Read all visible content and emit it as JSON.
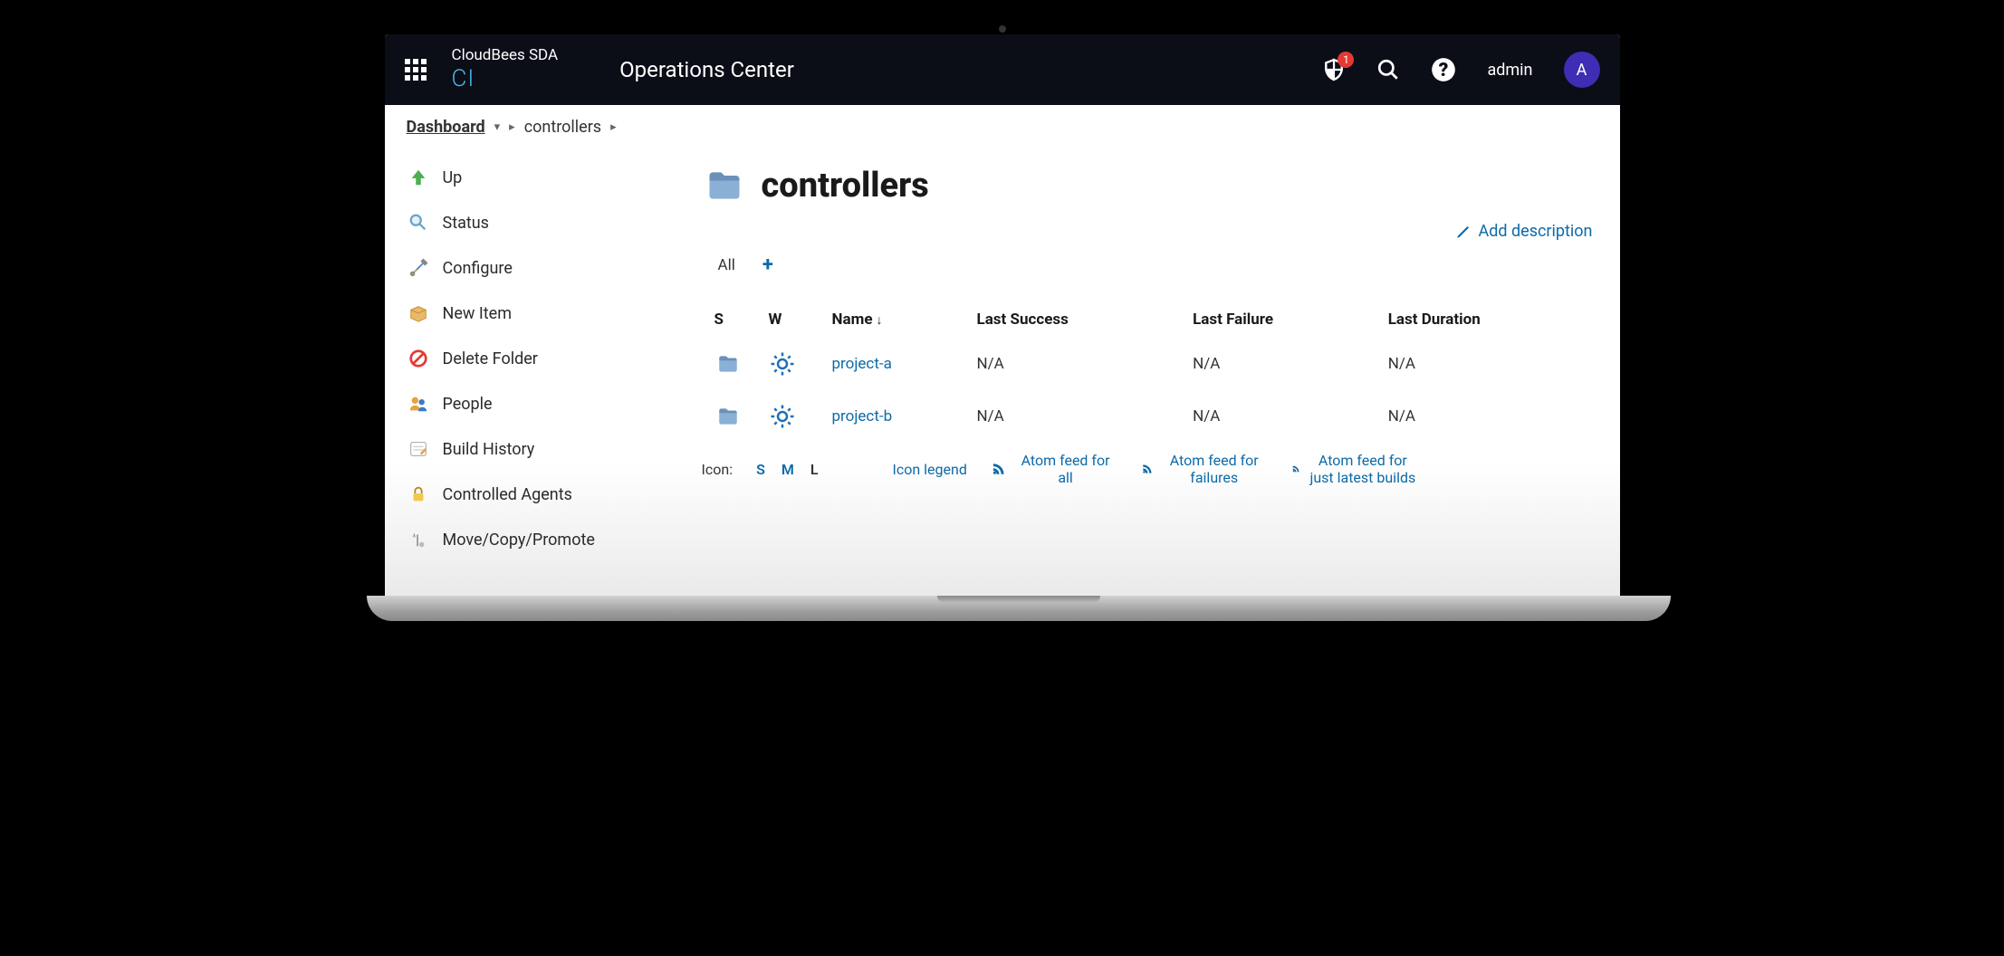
{
  "header": {
    "brand_top": "CloudBees SDA",
    "brand_bottom": "CI",
    "page_title": "Operations Center",
    "alert_count": "1",
    "user_name": "admin",
    "avatar_initial": "A"
  },
  "breadcrumb": {
    "root": "Dashboard",
    "current": "controllers"
  },
  "sidebar": {
    "items": [
      {
        "label": "Up"
      },
      {
        "label": "Status"
      },
      {
        "label": "Configure"
      },
      {
        "label": "New Item"
      },
      {
        "label": "Delete Folder"
      },
      {
        "label": "People"
      },
      {
        "label": "Build History"
      },
      {
        "label": "Controlled Agents"
      },
      {
        "label": "Move/Copy/Promote"
      }
    ]
  },
  "main": {
    "folder_title": "controllers",
    "add_description": "Add description",
    "tabs": {
      "all": "All"
    },
    "table": {
      "headers": {
        "s": "S",
        "w": "W",
        "name": "Name",
        "last_success": "Last Success",
        "last_failure": "Last Failure",
        "last_duration": "Last Duration"
      },
      "rows": [
        {
          "name": "project-a",
          "last_success": "N/A",
          "last_failure": "N/A",
          "last_duration": "N/A"
        },
        {
          "name": "project-b",
          "last_success": "N/A",
          "last_failure": "N/A",
          "last_duration": "N/A"
        }
      ]
    },
    "footer": {
      "icon_label": "Icon:",
      "size_s": "S",
      "size_m": "M",
      "size_l": "L",
      "legend": "Icon legend",
      "feed_all": "Atom feed for all",
      "feed_failures": "Atom feed for failures",
      "feed_latest": "Atom feed for just latest builds"
    }
  }
}
